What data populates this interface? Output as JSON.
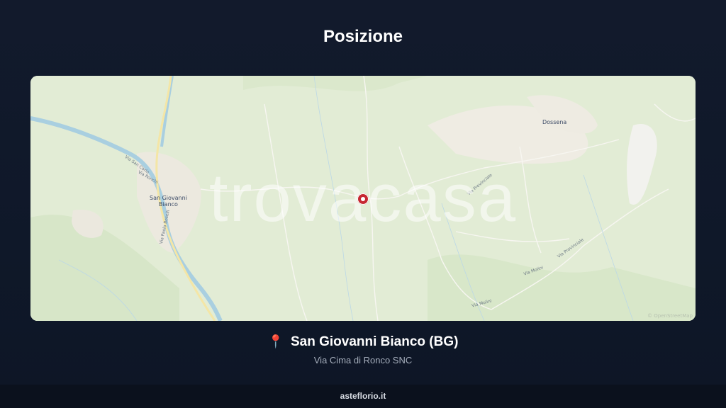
{
  "header": {
    "title": "Posizione"
  },
  "map": {
    "watermark": "trovacasa",
    "attribution": "© OpenStreetMap",
    "places": {
      "town_main": "San Giovanni\nBianco",
      "town_east": "Dossena"
    },
    "roads": {
      "r1": "Via San Carlo",
      "r2": "Via Paolo Boselli",
      "r3": "Via Ronchi",
      "r4": "Via Provinciale",
      "r5": "Via Provinciale",
      "r6": "Via Molini",
      "r7": "Via Molini"
    },
    "marker_icon": "location-marker-icon"
  },
  "location": {
    "pin_icon": "📍",
    "name": "San Giovanni Bianco (BG)",
    "address": "Via Cima di Ronco SNC"
  },
  "footer": {
    "site": "asteflorio.it"
  },
  "colors": {
    "background": "#111a2b",
    "map_land": "#e3edd6",
    "river": "#a9cfe0",
    "marker": "#c62832"
  }
}
